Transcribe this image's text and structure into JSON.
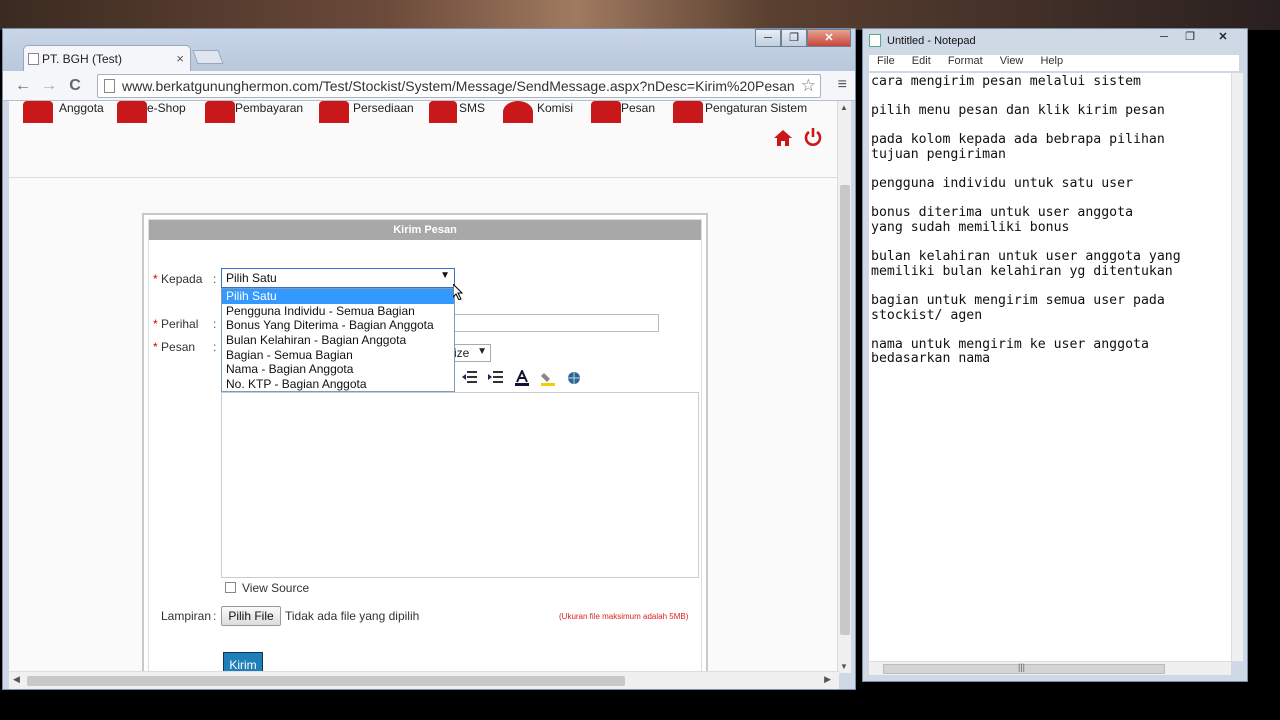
{
  "browser": {
    "tab_title": "PT. BGH (Test)",
    "tab_close": "×",
    "url": "www.berkatgununghermon.com/Test/Stockist/System/Message/SendMessage.aspx?nDesc=Kirim%20Pesan",
    "win_min": "─",
    "win_max": "❐",
    "win_close": "✕",
    "back": "←",
    "forward": "→",
    "reload": "C",
    "star": "☆",
    "menu": "≡"
  },
  "site_menu": {
    "items": [
      {
        "label": "Anggota"
      },
      {
        "label": "e-Shop"
      },
      {
        "label": "Pembayaran"
      },
      {
        "label": "Persediaan"
      },
      {
        "label": "SMS"
      },
      {
        "label": "Komisi"
      },
      {
        "label": "Pesan"
      },
      {
        "label": "Pengaturan Sistem"
      }
    ]
  },
  "form": {
    "header": "Kirim Pesan",
    "required_mark": "*",
    "colon": ":",
    "kepada_label": "Kepada",
    "perihal_label": "Perihal",
    "pesan_label": "Pesan",
    "lampiran_label": "Lampiran",
    "select_value": "Pilih Satu",
    "select_arrow": "▼",
    "options": [
      "Pilih Satu",
      "Pengguna Individu - Semua Bagian",
      "Bonus Yang Diterima - Bagian Anggota",
      "Bulan Kelahiran - Bagian Anggota",
      "Bagian - Semua Bagian",
      "Nama - Bagian Anggota",
      "No. KTP - Bagian Anggota"
    ],
    "size_select": "ize",
    "view_source": "View Source",
    "file_button": "Pilih File",
    "file_status": "Tidak ada file yang dipilih",
    "file_note": "(Ukuran file maksimum adalah 5MB)",
    "send_button": "Kirim"
  },
  "notepad": {
    "title": "Untitled - Notepad",
    "menus": [
      "File",
      "Edit",
      "Format",
      "View",
      "Help"
    ],
    "hs_grip": "|||",
    "lines": [
      "cara mengirim pesan melalui sistem",
      "",
      "pilih menu pesan dan klik kirim pesan",
      "",
      "pada kolom kepada ada bebrapa pilihan",
      "tujuan pengiriman",
      "",
      "pengguna individu untuk satu user",
      "",
      "bonus diterima untuk user anggota",
      "yang sudah memiliki bonus",
      "",
      "bulan kelahiran untuk user anggota yang",
      "memiliki bulan kelahiran yg ditentukan",
      "",
      "bagian untuk mengirim semua user pada",
      "stockist/ agen",
      "",
      "nama untuk mengirim ke user anggota",
      "bedasarkan nama"
    ]
  }
}
